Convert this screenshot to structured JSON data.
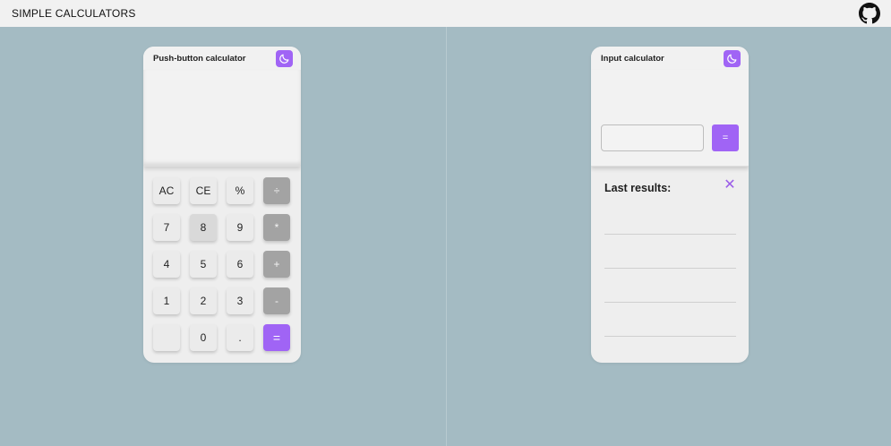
{
  "app": {
    "title": "SIMPLE CALCULATORS",
    "repo_icon": "github-icon"
  },
  "push_calculator": {
    "title": "Push-button calculator",
    "theme_icon": "moon-icon",
    "display_value": "",
    "keys": [
      {
        "label": "AC",
        "kind": "fn"
      },
      {
        "label": "CE",
        "kind": "fn"
      },
      {
        "label": "%",
        "kind": "fn"
      },
      {
        "label": "÷",
        "kind": "op"
      },
      {
        "label": "7",
        "kind": "num"
      },
      {
        "label": "8",
        "kind": "num",
        "pressed": true
      },
      {
        "label": "9",
        "kind": "num"
      },
      {
        "label": "*",
        "kind": "op"
      },
      {
        "label": "4",
        "kind": "num"
      },
      {
        "label": "5",
        "kind": "num"
      },
      {
        "label": "6",
        "kind": "num"
      },
      {
        "label": "+",
        "kind": "op"
      },
      {
        "label": "1",
        "kind": "num"
      },
      {
        "label": "2",
        "kind": "num"
      },
      {
        "label": "3",
        "kind": "num"
      },
      {
        "label": "-",
        "kind": "op"
      },
      {
        "label": "",
        "kind": "num"
      },
      {
        "label": "0",
        "kind": "num"
      },
      {
        "label": ".",
        "kind": "num"
      },
      {
        "label": "=",
        "kind": "eq"
      }
    ]
  },
  "input_calculator": {
    "title": "Input calculator",
    "theme_icon": "moon-icon",
    "input_value": "",
    "input_placeholder": "",
    "equals_label": "=",
    "results_title": "Last results:",
    "close_icon": "close-icon",
    "results": [
      "",
      "",
      "",
      ""
    ]
  },
  "colors": {
    "accent": "#a064f5",
    "background": "#a4bbc3",
    "operator": "#a3a3a3"
  }
}
